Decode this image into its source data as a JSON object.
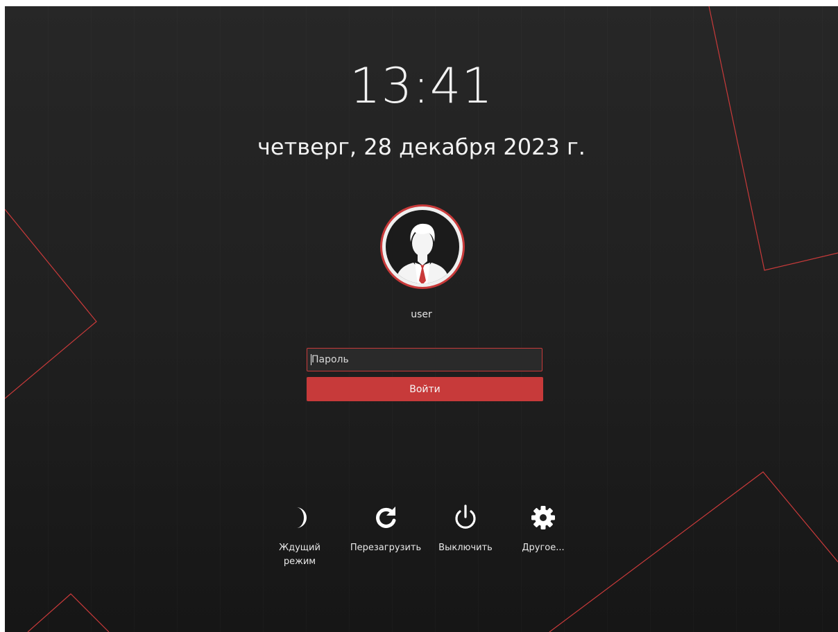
{
  "clock": {
    "time": "13:41"
  },
  "date": {
    "text": "четверг, 28 декабря 2023 г."
  },
  "user": {
    "name": "user",
    "avatar_icon": "businessman-avatar-icon"
  },
  "login": {
    "password_placeholder": "Пароль",
    "password_value": "",
    "submit_label": "Войти"
  },
  "actions": [
    {
      "id": "suspend",
      "label_line1": "Ждущий",
      "label_line2": "режим",
      "icon": "moon-icon"
    },
    {
      "id": "reboot",
      "label": "Перезагрузить",
      "icon": "reload-icon"
    },
    {
      "id": "shutdown",
      "label": "Выключить",
      "icon": "power-icon"
    },
    {
      "id": "other",
      "label": "Другое...",
      "icon": "gear-icon"
    }
  ],
  "colors": {
    "accent": "#c73a3a",
    "background": "#222222",
    "text": "#f2f2f2"
  }
}
